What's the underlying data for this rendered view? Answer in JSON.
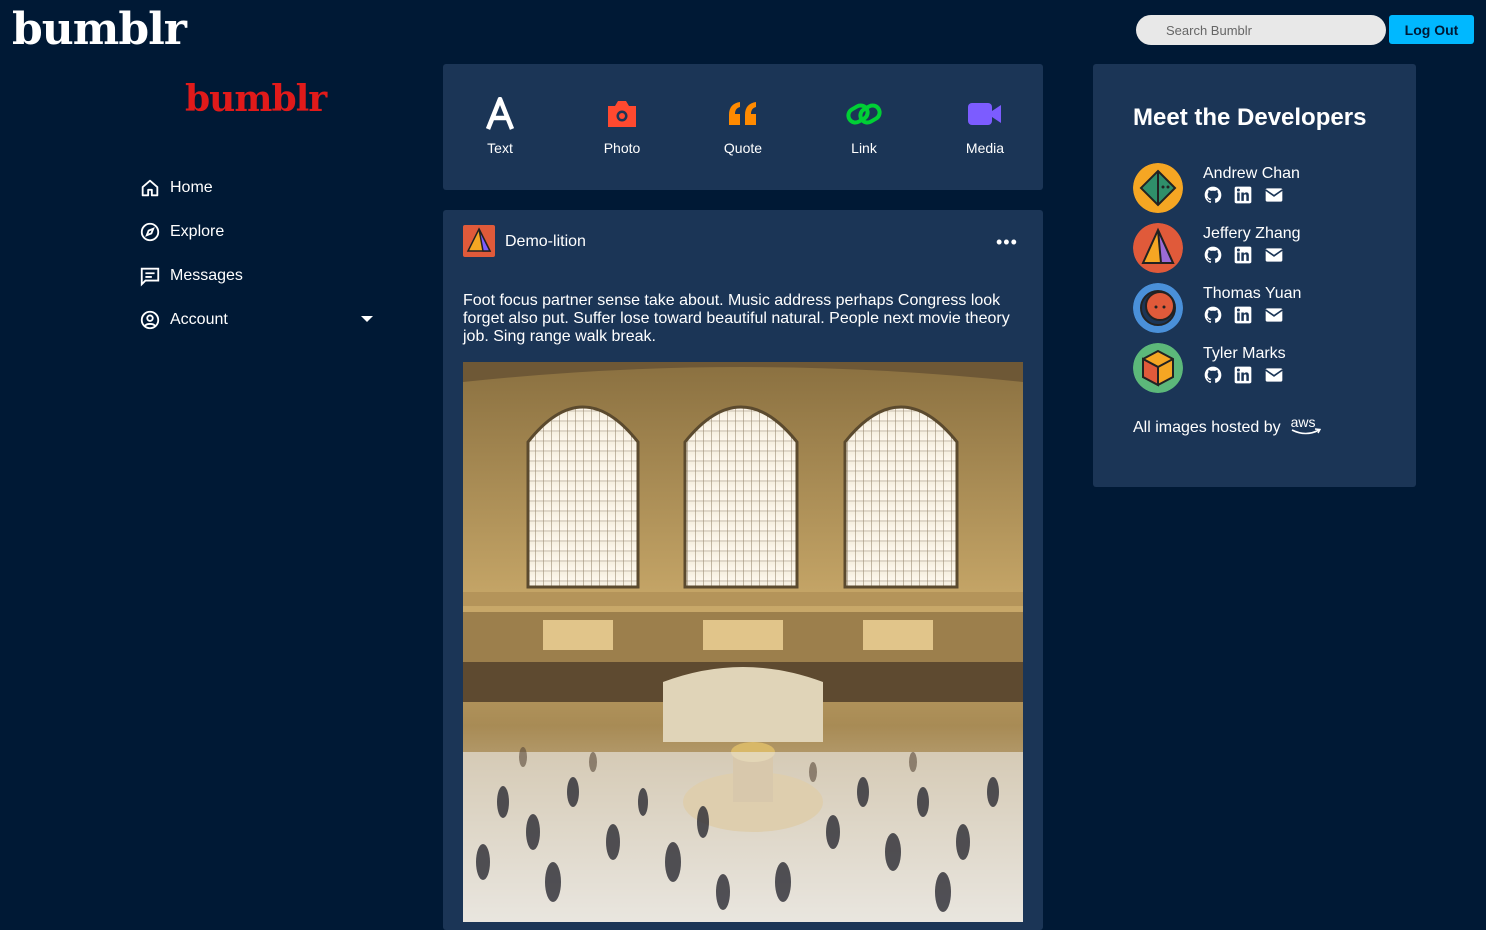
{
  "header": {
    "logo": "bumblr",
    "search_placeholder": "Search Bumblr",
    "logout_label": "Log Out"
  },
  "sidebar": {
    "logo": "bumblr",
    "items": [
      {
        "label": "Home",
        "icon": "home-icon"
      },
      {
        "label": "Explore",
        "icon": "compass-icon"
      },
      {
        "label": "Messages",
        "icon": "message-icon"
      },
      {
        "label": "Account",
        "icon": "account-icon"
      }
    ]
  },
  "post_types": [
    {
      "label": "Text",
      "icon": "text-icon",
      "color": "#ffffff"
    },
    {
      "label": "Photo",
      "icon": "camera-icon",
      "color": "#ff492f"
    },
    {
      "label": "Quote",
      "icon": "quote-icon",
      "color": "#ff8a00"
    },
    {
      "label": "Link",
      "icon": "link-icon",
      "color": "#00cf35"
    },
    {
      "label": "Media",
      "icon": "video-icon",
      "color": "#7c5cff"
    }
  ],
  "post": {
    "username": "Demo-lition",
    "more": "•••",
    "body": "Foot focus partner sense take about. Music address perhaps Congress look forget also put. Suffer lose toward beautiful natural. People next movie theory job. Sing range walk break."
  },
  "developers": {
    "title": "Meet the Developers",
    "people": [
      {
        "name": "Andrew Chan",
        "avatar_color": "#f5a623"
      },
      {
        "name": "Jeffery Zhang",
        "avatar_color": "#e05a3a"
      },
      {
        "name": "Thomas Yuan",
        "avatar_color": "#4a90d9"
      },
      {
        "name": "Tyler Marks",
        "avatar_color": "#5cb87a"
      }
    ],
    "hosted_label": "All images hosted by",
    "hosted_logo": "aws"
  },
  "colors": {
    "background": "#001935",
    "panel": "#1b3556",
    "accent": "#00b8ff",
    "logo_red": "#e11a1a"
  }
}
